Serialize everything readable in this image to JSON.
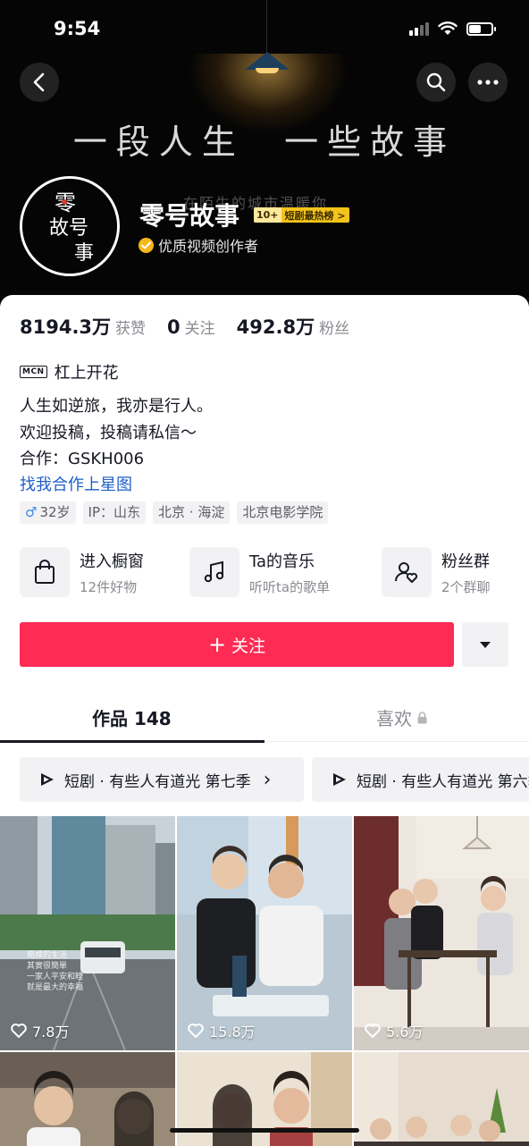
{
  "status_bar": {
    "time": "9:54"
  },
  "header": {
    "banner_title": "一段人生  一些故事",
    "banner_subtitle": "在陌生的城市温暖你",
    "avatar_text_1": "零",
    "avatar_text_2": "故号",
    "avatar_text_3": "事",
    "name": "零号故事",
    "rank_number": "10+",
    "rank_label": "短剧最热榜 >",
    "verified_label": "优质视频创作者"
  },
  "stats": [
    {
      "value": "8194.3万",
      "label": "获赞"
    },
    {
      "value": "0",
      "label": "关注"
    },
    {
      "value": "492.8万",
      "label": "粉丝"
    }
  ],
  "mcn": {
    "tag": "MCN",
    "name": "杠上开花"
  },
  "bio": {
    "line1": "人生如逆旅，我亦是行人。",
    "line2": "欢迎投稿，投稿请私信～",
    "line3": "合作：GSKH006",
    "link": "找我合作上星图"
  },
  "tags": {
    "gender_symbol": "♂",
    "age": "32岁",
    "ip": "IP：山东",
    "location": "北京 · 海淀",
    "school": "北京电影学院"
  },
  "entries": [
    {
      "title": "进入橱窗",
      "subtitle": "12件好物",
      "icon": "shopping-bag-icon"
    },
    {
      "title": "Ta的音乐",
      "subtitle": "听听ta的歌单",
      "icon": "music-note-icon"
    },
    {
      "title": "粉丝群",
      "subtitle": "2个群聊",
      "icon": "fan-group-icon"
    }
  ],
  "follow_button": {
    "plus": "+",
    "label": "关注"
  },
  "tabs": {
    "works": "作品 148",
    "likes": "喜欢"
  },
  "series": [
    {
      "label": "短剧 · 有些人有道光 第七季",
      "arrow": "›"
    },
    {
      "label": "短剧 · 有些人有道光 第六季",
      "arrow": "›"
    }
  ],
  "videos": [
    {
      "likes": "7.8万",
      "caption": [
        "簡樸的生活",
        "其實很簡單",
        "一家人平安和睦",
        "就是最大的幸福"
      ]
    },
    {
      "likes": "15.8万"
    },
    {
      "likes": "5.6万"
    },
    {},
    {},
    {}
  ],
  "colors": {
    "accent": "#fe2c55",
    "link": "#1f5ec8",
    "badge": "#f5c41b"
  }
}
